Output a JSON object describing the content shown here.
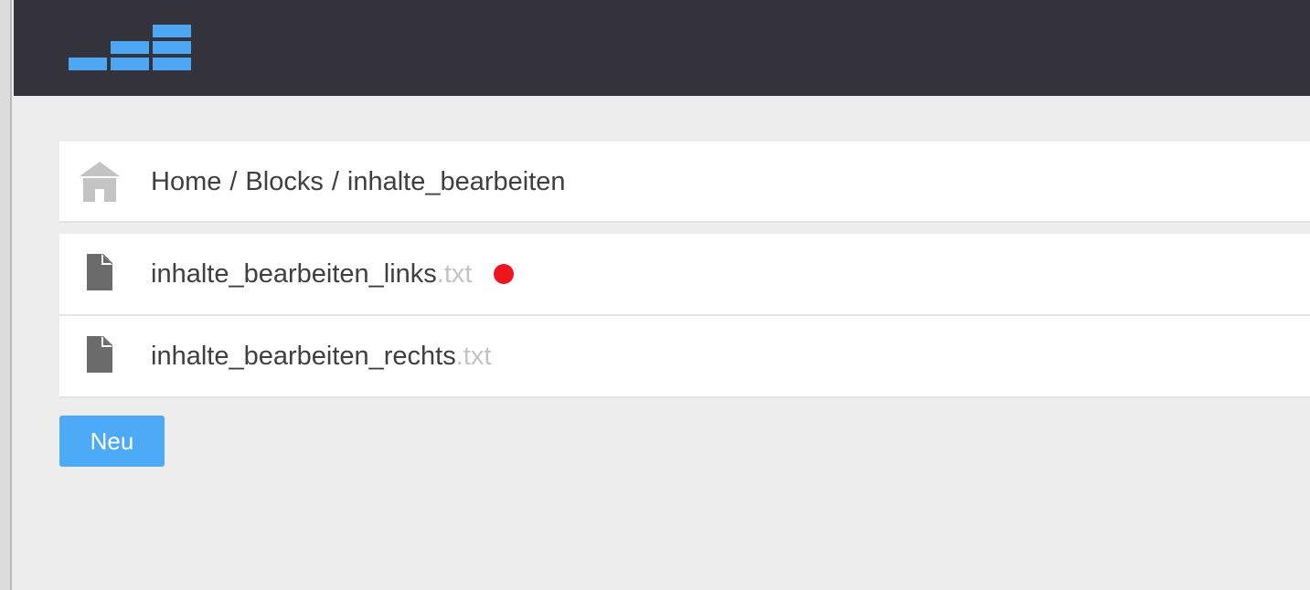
{
  "header": {
    "logo_icon": "bar-stairs-logo-icon",
    "accent_color": "#4da6f4",
    "background_color": "#34333b"
  },
  "breadcrumb": {
    "icon": "home-icon",
    "items": [
      {
        "label": "Home"
      },
      {
        "label": "Blocks"
      },
      {
        "label": "inhalte_bearbeiten"
      }
    ],
    "separator": "/"
  },
  "files": [
    {
      "icon": "file-icon",
      "name": "inhalte_bearbeiten_links",
      "extension": ".txt",
      "status": "unsaved",
      "status_color": "#f0141e"
    },
    {
      "icon": "file-icon",
      "name": "inhalte_bearbeiten_rechts",
      "extension": ".txt"
    }
  ],
  "actions": {
    "new_label": "Neu",
    "new_color": "#4daaf6"
  }
}
